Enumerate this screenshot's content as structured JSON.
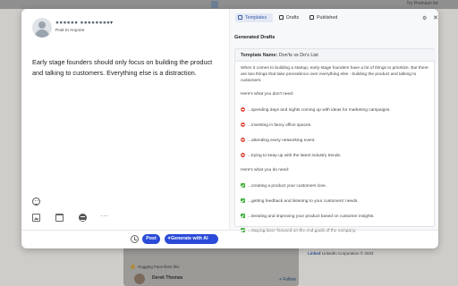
{
  "background": {
    "premium_text": "Try Premium for",
    "feed_header": "Hugging Face likes this",
    "post_author": "Derek Thomas",
    "follow_label": "+ Follow",
    "footer_brand": "Linked",
    "footer_text": "LinkedIn Corporation © 2023"
  },
  "composer": {
    "user_name": "●●●●●● ●●●●●●●●",
    "caret": "▾",
    "audience": "Post to Anyone",
    "post_text": "Early stage founders should only focus on building the product and talking to customers. Everything else is a distraction.",
    "more_glyph": "···",
    "post_label": "Post",
    "generate_label": "Generate with AI"
  },
  "panel": {
    "tabs": [
      "Templates",
      "Drafts",
      "Published"
    ],
    "active_tab": "Templates",
    "section_title": "Generated Drafts",
    "template_label": "Template Name:",
    "template_name": "Don'ts vs Do's List",
    "intro": "When it comes to building a startup, early-stage founders have a lot of things to prioritize. But there are two things that take precedence over everything else - building the product and talking to customers.",
    "dont_heading": "Here's what you don't need:",
    "donts": [
      "...spending days and nights coming up with ideas for marketing campaigns.",
      "...investing in fancy office spaces.",
      "...attending every networking event.",
      "...trying to keep up with the latest industry trends."
    ],
    "do_heading": "Here's what you do need:",
    "dos": [
      "...creating a product your customers love.",
      "...getting feedback and listening to your customers' needs.",
      "...iterating and improving your product based on customer insights.",
      "...staying laser-focused on the end goals of the company."
    ],
    "close_glyph": "✕"
  },
  "colors": {
    "primary_button": "#2a4bd8",
    "active_tab": "#3a5ba6",
    "dont_mark": "#e04c3f",
    "do_mark": "#3fae3a"
  }
}
